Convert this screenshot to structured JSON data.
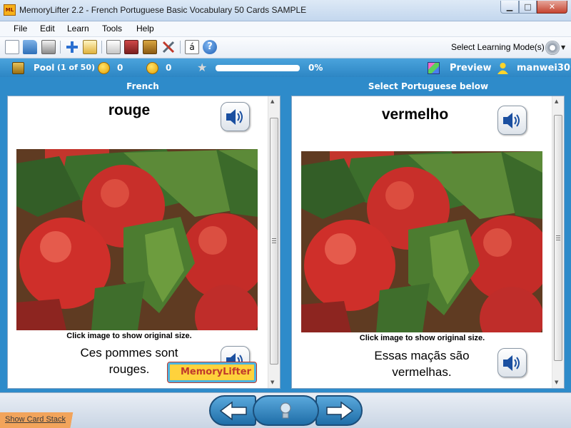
{
  "window": {
    "title": "MemoryLifter 2.2 - French Portuguese Basic Vocabulary 50 Cards SAMPLE",
    "app_icon_text": "ML",
    "minimize_label": "▁",
    "maximize_label": "□",
    "close_label": "✕"
  },
  "menu": {
    "items": [
      {
        "label": "File"
      },
      {
        "label": "Edit"
      },
      {
        "label": "Learn"
      },
      {
        "label": "Tools"
      },
      {
        "label": "Help"
      }
    ]
  },
  "toolbar": {
    "icons": [
      "new-document-icon",
      "open-folder-icon",
      "print-icon",
      "add-card-icon",
      "edit-card-icon",
      "presentation-icon",
      "card-view-icon",
      "statistics-icon",
      "tools-icon",
      "character-map-icon",
      "help-icon"
    ],
    "char_map_label": "á",
    "help_label": "?",
    "learning_mode_label": "Select Learning Mode(s)"
  },
  "status": {
    "pool_label": "Pool",
    "pool_count": "(1 of 50)",
    "correct_count": "0",
    "wrong_count": "0",
    "progress_percent": 0,
    "progress_label": "0%",
    "preview_label": "Preview",
    "username": "manwei30"
  },
  "question": {
    "header": "French",
    "word": "rouge",
    "image_caption": "Click image to show original size.",
    "sentence": "Ces pommes sont rouges."
  },
  "answer": {
    "header": "Select Portuguese below",
    "word": "vermelho",
    "image_caption": "Click image to show original size.",
    "sentence": "Essas maçãs são vermelhas."
  },
  "logo_text": "MemoryLifter",
  "show_card_stack_label": "Show Card Stack",
  "colors": {
    "status_blue": "#2e8bca",
    "progress_fill": "#8bd35b",
    "nav_blue": "#2b7fbd"
  }
}
